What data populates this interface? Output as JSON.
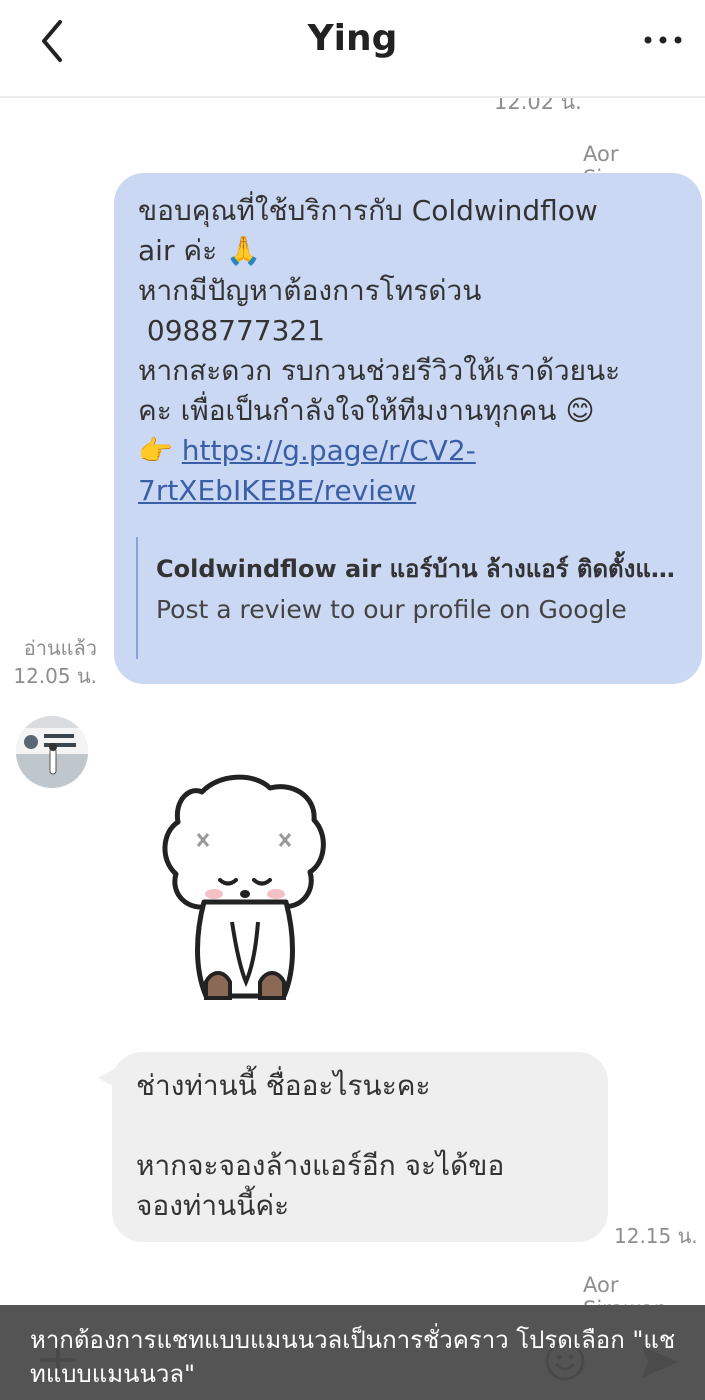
{
  "header": {
    "title": "Ying",
    "back_icon": "chevron-left-icon",
    "more_icon": "more-horizontal-icon"
  },
  "previous_message": {
    "time": "12.02 น."
  },
  "outgoing_message": {
    "sender": "Aor Sirawan",
    "lines": [
      "ขอบคุณที่ใช้บริการกับ Coldwindflow",
      "air ค่ะ 🙏",
      "หากมีปัญหาต้องการโทรด่วน",
      " 0988777321",
      "หากสะดวก รบกวนช่วยรีวิวให้เราด้วยนะ",
      "คะ เพื่อเป็นกำลังใจให้ทีมงานทุกคน 😊"
    ],
    "link_emoji": "👉",
    "link_line1": "https://g.page/r/CV2-",
    "link_line2": "7rtXEbIKEBE/review",
    "preview_title": "Coldwindflow air แอร์บ้าน ล้างแอร์ ติดตั้งแอร์",
    "preview_desc": "Post a review to our profile on Google",
    "read_label": "อ่านแล้ว",
    "time": "12.05 น."
  },
  "incoming_sticker": {
    "avatar_icon": "contact-avatar",
    "sticker_icon": "bowing-bear-sticker"
  },
  "incoming_message": {
    "line1": "ช่างท่านนี้ ชื่ออะไรนะคะ",
    "line2": "หากจะจองล้างแอร์อีก จะได้ขอ",
    "line3": "จองท่านนี้ค่ะ",
    "time": "12.15 น."
  },
  "next_sender": "Aor Sirawan",
  "composer": {
    "plus_icon": "plus-icon",
    "emoji_icon": "emoji-icon",
    "send_icon": "send-icon"
  },
  "toast": {
    "line1": "หากต้องการแชทแบบแมนนวลเป็นการชั่วคราว โปรดเลือก \"แช",
    "line2": "ทแบบแมนนวล\""
  },
  "colors": {
    "outgoing_bubble": "#cbd8f4",
    "incoming_bubble": "#efefef",
    "link": "#3b5fa6",
    "meta_text": "#8e8e8e",
    "toast_bg": "#484848"
  }
}
